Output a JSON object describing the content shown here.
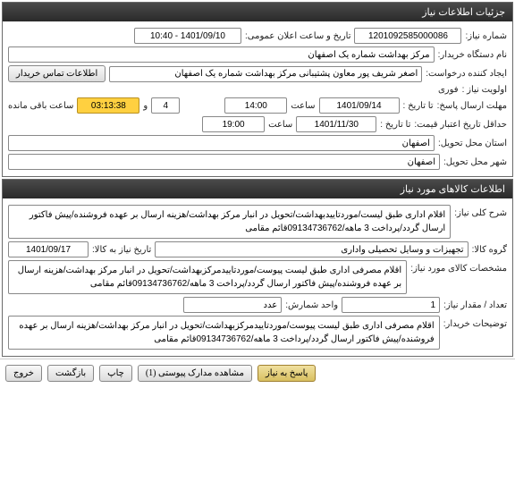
{
  "sections": {
    "info_header": "جزئیات اطلاعات نیاز",
    "goods_header": "اطلاعات کالاهای مورد نیاز"
  },
  "info": {
    "need_no_label": "شماره نیاز:",
    "need_no": "1201092585000086",
    "announce_label": "تاریخ و ساعت اعلان عمومی:",
    "announce": "1401/09/10 - 10:40",
    "org_label": "نام دستگاه خریدار:",
    "org": "مرکز بهداشت شماره یک اصفهان",
    "creator_label": "ایجاد کننده درخواست:",
    "creator": "اصغر شریف پور معاون پشتیبانی مرکز بهداشت شماره یک اصفهان",
    "contact_btn": "اطلاعات تماس خریدار",
    "priority_label": "اولویت نیاز :",
    "priority": "فوری",
    "reply_deadline_label": "مهلت ارسال پاسخ:",
    "from_date_label": "تا تاریخ :",
    "reply_date": "1401/09/14",
    "time_label": "ساعت",
    "reply_time": "14:00",
    "and_label": "و",
    "days": "4",
    "remain_label": "ساعت باقی مانده",
    "remain_time": "03:13:38",
    "quote_valid_label": "حداقل تاریخ اعتبار قیمت:",
    "quote_date": "1401/11/30",
    "quote_time": "19:00",
    "province_label": "استان محل تحویل:",
    "province": "اصفهان",
    "city_label": "شهر محل تحویل:",
    "city": "اصفهان"
  },
  "goods": {
    "desc_label": "شرح کلی نیاز:",
    "desc": "اقلام اداری طبق لیست/موردتاییدبهداشت/تحویل در انبار مرکز بهداشت/هزینه ارسال بر عهده فروشنده/پیش فاکتور ارسال گردد/پرداخت 3 ماهه/09134736762قائم مقامی",
    "group_label": "گروه کالا:",
    "group": "تجهیزات و وسایل تحصیلی واداری",
    "group_date_label": "تاریخ نیاز به کالا:",
    "group_date": "1401/09/17",
    "spec_label": "مشخصات کالای مورد نیاز:",
    "spec": "اقلام مصرفی اداری طبق لیست پیوست/موردتاییدمرکزبهداشت/تحویل در انبار مرکز بهداشت/هزینه ارسال بر عهده فروشنده/پیش فاکتور ارسال گردد/پرداخت 3 ماهه/09134736762قائم مقامی",
    "qty_label": "تعداد / مقدار نیاز:",
    "qty": "1",
    "unit_label": "واحد شمارش:",
    "unit": "عدد",
    "buyer_notes_label": "توضیحات خریدار:",
    "buyer_notes": "اقلام مصرفی اداری طبق لیست پیوست/موردتاییدمرکزبهداشت/تحویل در انبار مرکز بهداشت/هزینه ارسال بر عهده فروشنده/پیش فاکتور ارسال گردد/پرداخت 3 ماهه/09134736762قائم مقامی"
  },
  "footer": {
    "reply": "پاسخ به نیاز",
    "attachments": "مشاهده مدارک پیوستی (1)",
    "print": "چاپ",
    "back": "بازگشت",
    "exit": "خروج"
  }
}
